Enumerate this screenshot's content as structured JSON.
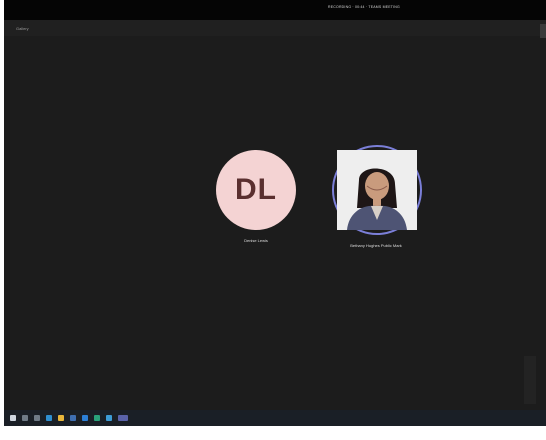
{
  "window": {
    "title": "RECORDING · 00:44 · TEAMS MEETING"
  },
  "toolbar": {
    "view_label": "Gallery"
  },
  "participants": [
    {
      "initials": "DL",
      "name": "Denise Lewis",
      "avatar_color": "#f4d3d3",
      "initials_color": "#5a2f2f"
    },
    {
      "initials": "",
      "name": "Bethany Hughes Public Mark",
      "avatar_type": "photo",
      "ring_color": "#7b7fd8"
    }
  ],
  "taskbar": {
    "icons": [
      "windows-logo-icon",
      "search-icon",
      "task-view-icon",
      "edge-icon",
      "explorer-icon",
      "store-icon",
      "mail-icon",
      "teams-icon",
      "app-icon",
      "active-app-icon"
    ]
  },
  "colors": {
    "background": "#1c1c1c",
    "title_bar": "#050505",
    "accent_ring": "#7b7fd8"
  }
}
